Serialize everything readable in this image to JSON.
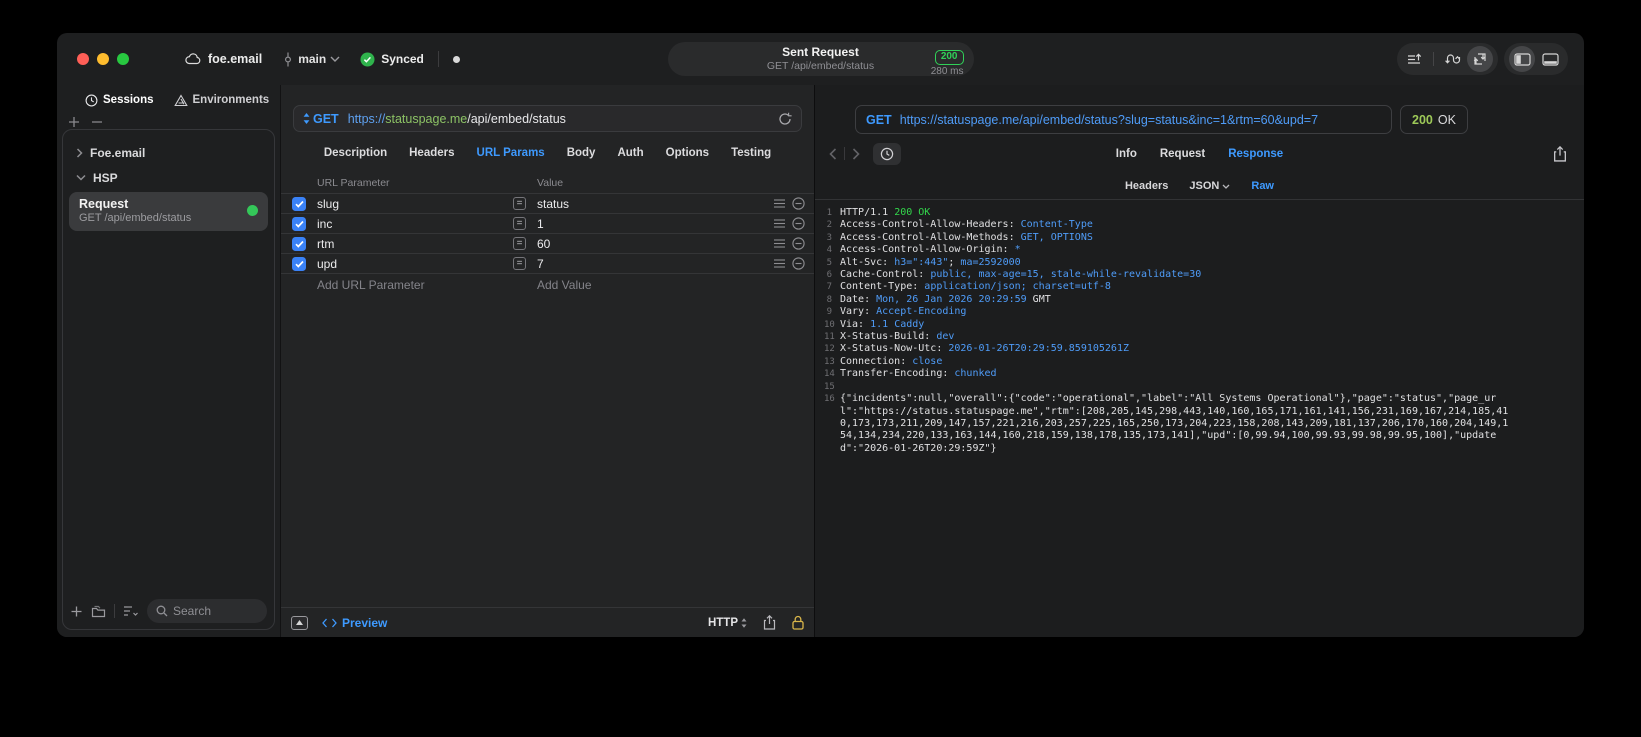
{
  "colors": {
    "accent": "#3e9aff",
    "badge_green": "#30d158",
    "status_green": "#9dc958",
    "resp_blue": "#4f9cf8",
    "resp_green": "#32d74b",
    "host_green": "#8cc265",
    "check_blue": "#3a82f7",
    "gold": "#d9b64a",
    "dot_green": "#34c759",
    "traffic_red": "#ff5f57",
    "traffic_yellow": "#febc2e",
    "traffic_green": "#28c840"
  },
  "titlebar": {
    "project": "foe.email",
    "branch": "main",
    "sync_label": "Synced",
    "center": {
      "title": "Sent Request",
      "subtitle": "GET /api/embed/status",
      "status_code": "200",
      "duration": "280 ms"
    }
  },
  "sidebar": {
    "tabs": [
      "Sessions",
      "Environments"
    ],
    "tree": [
      {
        "label": "Foe.email"
      },
      {
        "label": "HSP"
      }
    ],
    "request": {
      "title": "Request",
      "subtitle": "GET /api/embed/status"
    },
    "search_placeholder": "Search"
  },
  "request_panel": {
    "method": "GET",
    "url": {
      "scheme": "https://",
      "host": "statuspage.me",
      "path": "/api/embed/status"
    },
    "tabs": [
      "Description",
      "Headers",
      "URL Params",
      "Body",
      "Auth",
      "Options",
      "Testing"
    ],
    "active_tab": "URL Params",
    "table": {
      "columns": [
        "URL Parameter",
        "Value"
      ],
      "eq_symbol": "=",
      "rows": [
        {
          "name": "slug",
          "value": "status"
        },
        {
          "name": "inc",
          "value": "1"
        },
        {
          "name": "rtm",
          "value": "60"
        },
        {
          "name": "upd",
          "value": "7"
        }
      ],
      "add_name_placeholder": "Add URL Parameter",
      "add_value_placeholder": "Add Value"
    },
    "footer": {
      "preview_label": "Preview",
      "protocol": "HTTP"
    }
  },
  "response_panel": {
    "method": "GET",
    "url": "https://statuspage.me/api/embed/status?slug=status&inc=1&rtm=60&upd=7",
    "status_code": "200",
    "status_text": "OK",
    "tabs": [
      "Info",
      "Request",
      "Response"
    ],
    "active_tab": "Response",
    "subtabs": [
      "Headers",
      "JSON",
      "Raw"
    ],
    "active_subtab": "Raw",
    "lines": [
      {
        "num": "1",
        "parts": [
          {
            "t": "HTTP/1.1 ",
            "c": "plain"
          },
          {
            "t": "200 OK",
            "c": "green"
          }
        ]
      },
      {
        "num": "2",
        "parts": [
          {
            "t": "Access-Control-Allow-Headers: ",
            "c": "plain"
          },
          {
            "t": "Content-Type",
            "c": "blue"
          }
        ]
      },
      {
        "num": "3",
        "parts": [
          {
            "t": "Access-Control-Allow-Methods: ",
            "c": "plain"
          },
          {
            "t": "GET, OPTIONS",
            "c": "blue"
          }
        ]
      },
      {
        "num": "4",
        "parts": [
          {
            "t": "Access-Control-Allow-Origin: ",
            "c": "plain"
          },
          {
            "t": "*",
            "c": "blue"
          }
        ]
      },
      {
        "num": "5",
        "parts": [
          {
            "t": "Alt-Svc: ",
            "c": "plain"
          },
          {
            "t": "h3=\":443\"",
            "c": "blue"
          },
          {
            "t": "; ",
            "c": "plain"
          },
          {
            "t": "ma=2592000",
            "c": "blue"
          }
        ]
      },
      {
        "num": "6",
        "parts": [
          {
            "t": "Cache-Control: ",
            "c": "plain"
          },
          {
            "t": "public, max-age=15, stale-while-revalidate=30",
            "c": "blue"
          }
        ]
      },
      {
        "num": "7",
        "parts": [
          {
            "t": "Content-Type: ",
            "c": "plain"
          },
          {
            "t": "application/json; charset=utf-8",
            "c": "blue"
          }
        ]
      },
      {
        "num": "8",
        "parts": [
          {
            "t": "Date: ",
            "c": "plain"
          },
          {
            "t": "Mon, 26 Jan 2026 20:29:59 ",
            "c": "blue"
          },
          {
            "t": "GMT",
            "c": "plain"
          }
        ]
      },
      {
        "num": "9",
        "parts": [
          {
            "t": "Vary: ",
            "c": "plain"
          },
          {
            "t": "Accept-Encoding",
            "c": "blue"
          }
        ]
      },
      {
        "num": "10",
        "parts": [
          {
            "t": "Via: ",
            "c": "plain"
          },
          {
            "t": "1.1 Caddy",
            "c": "blue"
          }
        ]
      },
      {
        "num": "11",
        "parts": [
          {
            "t": "X-Status-Build: ",
            "c": "plain"
          },
          {
            "t": "dev",
            "c": "blue"
          }
        ]
      },
      {
        "num": "12",
        "parts": [
          {
            "t": "X-Status-Now-Utc: ",
            "c": "plain"
          },
          {
            "t": "2026-01-26T20:29:59.859105261Z",
            "c": "blue"
          }
        ]
      },
      {
        "num": "13",
        "parts": [
          {
            "t": "Connection: ",
            "c": "plain"
          },
          {
            "t": "close",
            "c": "blue"
          }
        ]
      },
      {
        "num": "14",
        "parts": [
          {
            "t": "Transfer-Encoding: ",
            "c": "plain"
          },
          {
            "t": "chunked",
            "c": "blue"
          }
        ]
      },
      {
        "num": "15",
        "parts": []
      },
      {
        "num": "16",
        "parts": [
          {
            "t": "{\"incidents\":null,\"overall\":{\"code\":\"operational\",\"label\":\"All Systems Operational\"},\"page\":\"status\",\"page_url\":\"https://status.statuspage.me\",\"rtm\":[208,205,145,298,443,140,160,165,171,161,141,156,231,169,167,214,185,410,173,173,211,209,147,157,221,216,203,257,225,165,250,173,204,223,158,208,143,209,181,137,206,170,160,204,149,154,134,234,220,133,163,144,160,218,159,138,178,135,173,141],\"upd\":[0,99.94,100,99.93,99.98,99.95,100],\"updated\":\"2026-01-26T20:29:59Z\"}",
            "c": "plain"
          }
        ]
      }
    ]
  }
}
